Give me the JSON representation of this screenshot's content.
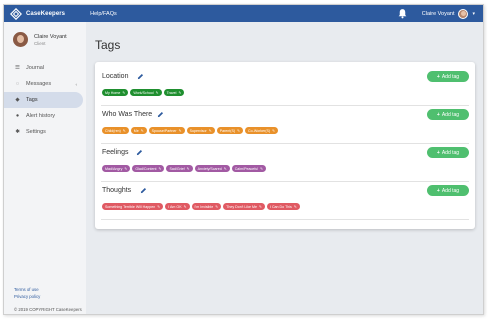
{
  "topbar": {
    "brand": "CaseKeepers",
    "help_link": "Help/FAQs",
    "user_name": "Claire Voyant",
    "caret": "▾"
  },
  "profile": {
    "name": "Claire Voyant",
    "role": "Client"
  },
  "sidebar": {
    "items": [
      {
        "label": "Journal",
        "icon": "journal-icon",
        "glyph": "☰"
      },
      {
        "label": "Messages",
        "icon": "chat-icon",
        "glyph": "◌",
        "chevron": "‹"
      },
      {
        "label": "Tags",
        "icon": "tag-icon",
        "glyph": "◆"
      },
      {
        "label": "Alert history",
        "icon": "alert-icon",
        "glyph": "●"
      },
      {
        "label": "Settings",
        "icon": "gear-icon",
        "glyph": "✱"
      }
    ],
    "footer_links": [
      "Terms of use",
      "Privacy policy"
    ],
    "copyright": "© 2019 COPYRIGHT CaseKeepers"
  },
  "page": {
    "title": "Tags"
  },
  "colors": {
    "topbar": "#2d5a9e",
    "add_button": "#4fbf6f",
    "location_tag": "#1f8f2f",
    "who_tag": "#e9912a",
    "feelings_tag": "#a25aa3",
    "thoughts_tag": "#e05a63"
  },
  "sections": [
    {
      "title": "Location",
      "add_label": "Add tag",
      "tag_color": "#1f8f2f",
      "tags": [
        "My Home",
        "Work/School",
        "Travel"
      ]
    },
    {
      "title": "Who Was There",
      "add_label": "Add tag",
      "tag_color": "#e9912a",
      "tags": [
        "Child(ren)",
        "Me",
        "Spouse/Partner",
        "Supervisor",
        "Parent(S)",
        "Co-Worker(S)"
      ]
    },
    {
      "title": "Feelings",
      "add_label": "Add tag",
      "tag_color": "#a25aa3",
      "tags": [
        "Mad/Angry",
        "Glad/Content",
        "Sad/Grief",
        "Anxiety/Scared",
        "Calm/Peaceful"
      ]
    },
    {
      "title": "Thoughts",
      "add_label": "Add tag",
      "tag_color": "#e05a63",
      "tags": [
        "Something Terrible Will Happen",
        "I Am OK",
        "I'm Invisible",
        "They Don't Like Me",
        "I Can Do This"
      ]
    }
  ]
}
